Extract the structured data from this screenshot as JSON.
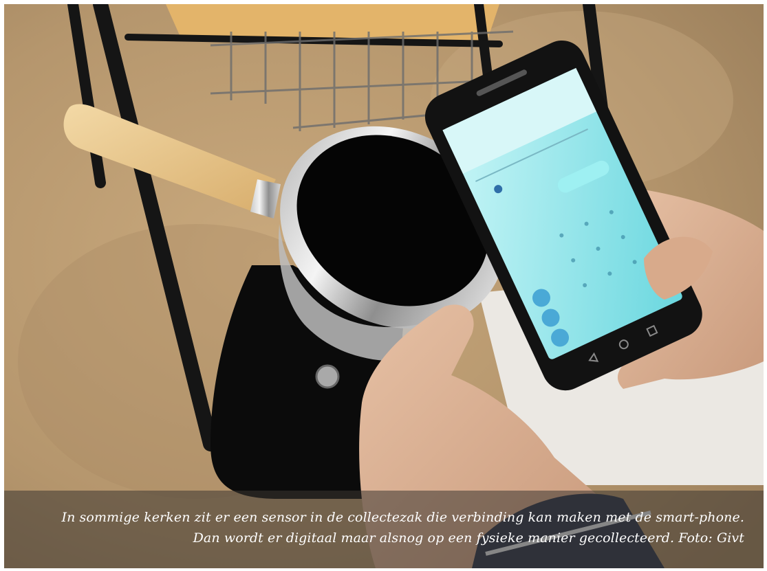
{
  "photo": {
    "caption": "In sommige kerken zit er een sensor in de collectezak die verbinding kan maken met de smart-phone. Dan wordt er digitaal maar alsnog op een fysieke manier gecollecteerd. Foto: Givt",
    "colors": {
      "carpet": "#b99a72",
      "bag": "#0a0a0a",
      "wood": "#e4c084",
      "screen": "#7fe0e6",
      "caption_bg": "#3c3732"
    }
  }
}
